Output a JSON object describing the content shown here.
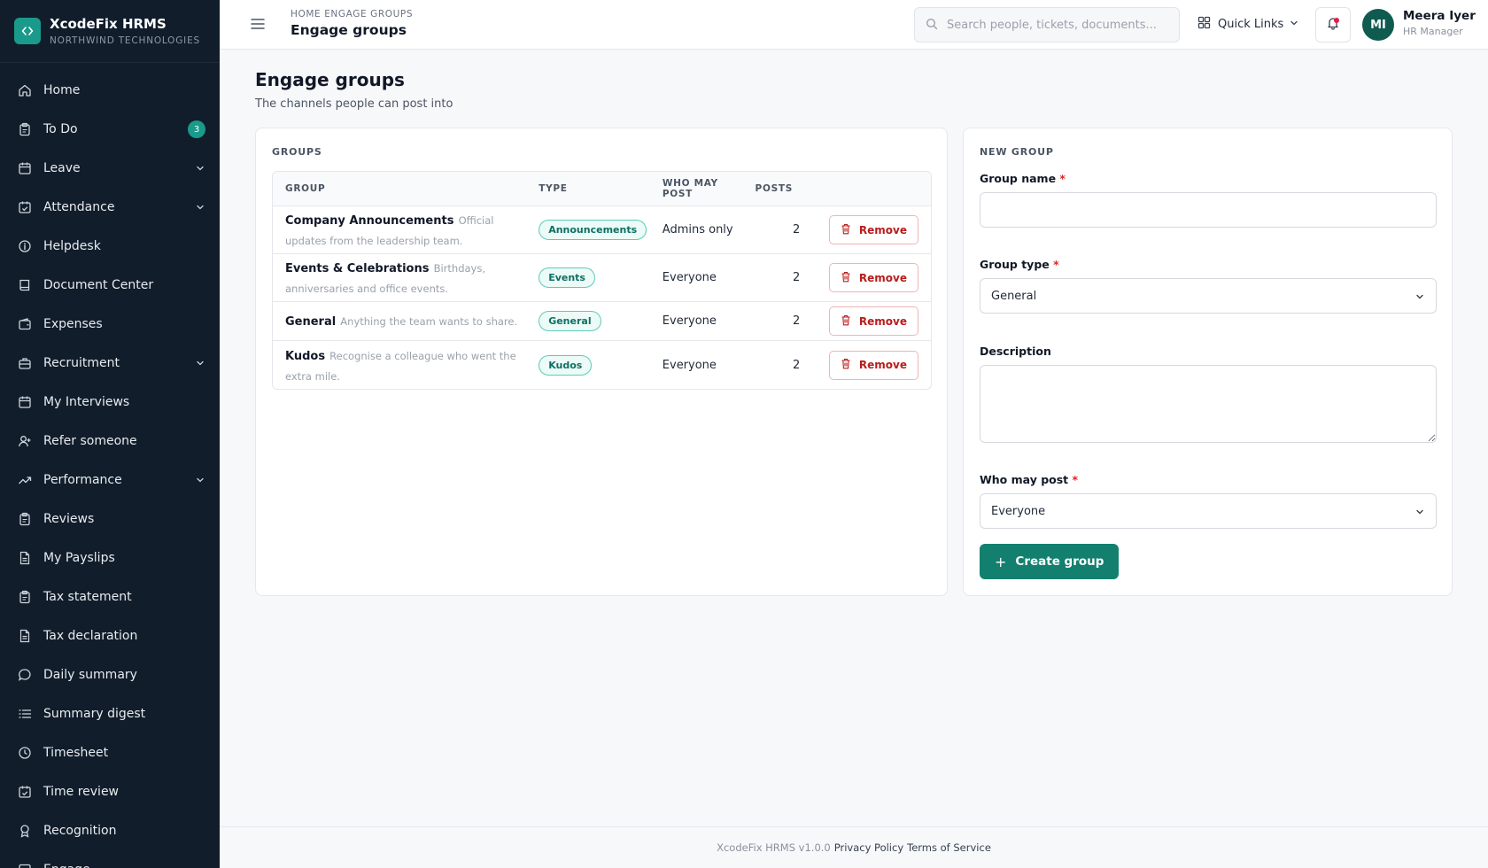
{
  "app": {
    "name": "XcodeFix HRMS",
    "org": "NORTHWIND TECHNOLOGIES"
  },
  "sidebar": {
    "items": [
      {
        "label": "Home",
        "icon": "home-icon"
      },
      {
        "label": "To Do",
        "icon": "clipboard-icon",
        "badge": "3"
      },
      {
        "label": "Leave",
        "icon": "calendar-icon",
        "expandable": true
      },
      {
        "label": "Attendance",
        "icon": "calendar-check-icon",
        "expandable": true
      },
      {
        "label": "Helpdesk",
        "icon": "info-icon"
      },
      {
        "label": "Document Center",
        "icon": "book-icon"
      },
      {
        "label": "Expenses",
        "icon": "wallet-icon"
      },
      {
        "label": "Recruitment",
        "icon": "briefcase-icon",
        "expandable": true
      },
      {
        "label": "My Interviews",
        "icon": "calendar-icon"
      },
      {
        "label": "Refer someone",
        "icon": "user-plus-icon"
      },
      {
        "label": "Performance",
        "icon": "trending-up-icon",
        "expandable": true
      },
      {
        "label": "Reviews",
        "icon": "clipboard-icon"
      },
      {
        "label": "My Payslips",
        "icon": "file-icon"
      },
      {
        "label": "Tax statement",
        "icon": "clipboard-icon"
      },
      {
        "label": "Tax declaration",
        "icon": "file-icon"
      },
      {
        "label": "Daily summary",
        "icon": "message-icon"
      },
      {
        "label": "Summary digest",
        "icon": "list-icon"
      },
      {
        "label": "Timesheet",
        "icon": "clock-icon"
      },
      {
        "label": "Time review",
        "icon": "calendar-check-icon"
      },
      {
        "label": "Recognition",
        "icon": "award-icon"
      },
      {
        "label": "Engage",
        "icon": "chat-icon"
      }
    ]
  },
  "header": {
    "breadcrumb": "HOME ENGAGE GROUPS",
    "title": "Engage groups",
    "search_placeholder": "Search people, tickets, documents...",
    "quick_links": "Quick Links",
    "user": {
      "initials": "MI",
      "name": "Meera Iyer",
      "role": "HR Manager"
    }
  },
  "page": {
    "title": "Engage groups",
    "subtitle": "The channels people can post into"
  },
  "groups": {
    "heading": "GROUPS",
    "columns": [
      "GROUP",
      "TYPE",
      "WHO MAY POST",
      "POSTS"
    ],
    "remove_label": "Remove",
    "rows": [
      {
        "name": "Company Announcements",
        "desc": "Official updates from the leadership team.",
        "type": "Announcements",
        "who": "Admins only",
        "posts": "2"
      },
      {
        "name": "Events & Celebrations",
        "desc": "Birthdays, anniversaries and office events.",
        "type": "Events",
        "who": "Everyone",
        "posts": "2"
      },
      {
        "name": "General",
        "desc": "Anything the team wants to share.",
        "type": "General",
        "who": "Everyone",
        "posts": "2"
      },
      {
        "name": "Kudos",
        "desc": "Recognise a colleague who went the extra mile.",
        "type": "Kudos",
        "who": "Everyone",
        "posts": "2"
      }
    ]
  },
  "new_group": {
    "heading": "NEW GROUP",
    "name_label": "Group name",
    "name_value": "",
    "type_label": "Group type",
    "type_value": "General",
    "desc_label": "Description",
    "desc_value": "",
    "who_label": "Who may post",
    "who_value": "Everyone",
    "required_mark": "*",
    "submit_label": "Create group"
  },
  "footer": {
    "version": "XcodeFix HRMS v1.0.0",
    "privacy": "Privacy Policy",
    "terms": "Terms of Service"
  },
  "colors": {
    "sidebar_bg": "#111d2b",
    "accent": "#13806f",
    "danger": "#b91c1c"
  }
}
